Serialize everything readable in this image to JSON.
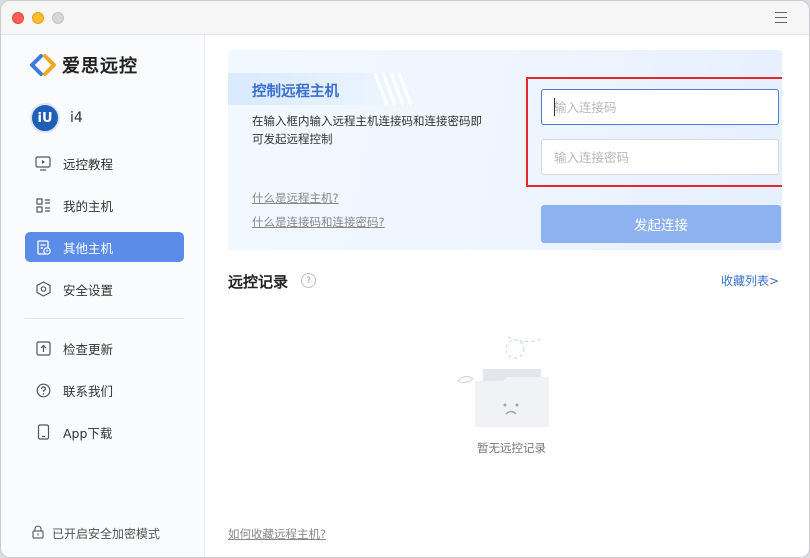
{
  "app": {
    "brand": "爱思远控"
  },
  "user": {
    "avatar_text": "iU",
    "name": "i4"
  },
  "sidebar": {
    "items": [
      {
        "label": "远控教程",
        "icon": "monitor-play-icon"
      },
      {
        "label": "我的主机",
        "icon": "grid-list-icon"
      },
      {
        "label": "其他主机",
        "icon": "document-clock-icon",
        "active": true
      },
      {
        "label": "安全设置",
        "icon": "shield-hexagon-icon"
      }
    ],
    "bottom_items": [
      {
        "label": "检查更新",
        "icon": "upload-box-icon"
      },
      {
        "label": "联系我们",
        "icon": "question-circle-icon"
      },
      {
        "label": "App下载",
        "icon": "phone-icon"
      }
    ],
    "secure_mode": "已开启安全加密模式"
  },
  "hero": {
    "title": "控制远程主机",
    "description": "在输入框内输入远程主机连接码和连接密码即可发起远程控制",
    "link1": "什么是远程主机?",
    "link2": "什么是连接码和连接密码?",
    "code_placeholder": "输入连接码",
    "password_placeholder": "输入连接密码",
    "connect_label": "发起连接"
  },
  "records": {
    "title": "远控记录",
    "help": "?",
    "fav_link": "收藏列表>",
    "empty_text": "暂无远控记录",
    "howto_link": "如何收藏远程主机?"
  },
  "colors": {
    "accent": "#5b8de8",
    "highlight_border": "#e5292d",
    "button": "#8eb2f0"
  }
}
